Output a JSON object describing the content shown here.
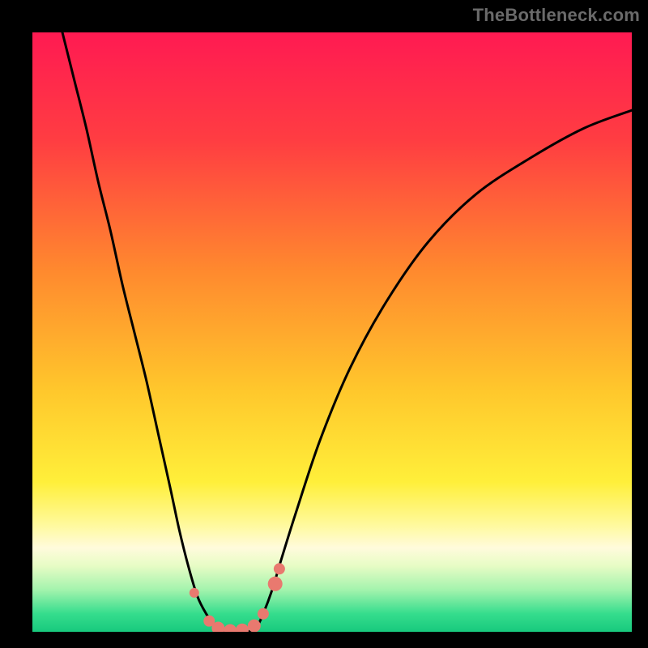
{
  "watermark": {
    "text": "TheBottleneck.com"
  },
  "colors": {
    "frame": "#000000",
    "gradient_stops": [
      {
        "offset": 0.0,
        "color": "#ff1a52"
      },
      {
        "offset": 0.18,
        "color": "#ff3d42"
      },
      {
        "offset": 0.4,
        "color": "#ff8a2e"
      },
      {
        "offset": 0.6,
        "color": "#ffc82c"
      },
      {
        "offset": 0.75,
        "color": "#ffef3a"
      },
      {
        "offset": 0.82,
        "color": "#fff99a"
      },
      {
        "offset": 0.86,
        "color": "#fffbdc"
      },
      {
        "offset": 0.89,
        "color": "#e7fcc5"
      },
      {
        "offset": 0.93,
        "color": "#a3f3ad"
      },
      {
        "offset": 0.97,
        "color": "#35dd8d"
      },
      {
        "offset": 1.0,
        "color": "#18c97d"
      }
    ],
    "curve": "#000000",
    "marker_fill": "#e9796f",
    "marker_stroke": "#d4645a"
  },
  "chart_data": {
    "type": "line",
    "title": "",
    "xlabel": "",
    "ylabel": "",
    "xlim": [
      0,
      100
    ],
    "ylim": [
      0,
      100
    ],
    "grid": false,
    "legend": false,
    "series": [
      {
        "name": "bottleneck-curve",
        "xy": [
          [
            5,
            100
          ],
          [
            7,
            92
          ],
          [
            9,
            84
          ],
          [
            11,
            75
          ],
          [
            13,
            67
          ],
          [
            15,
            58
          ],
          [
            17,
            50
          ],
          [
            19,
            42
          ],
          [
            21,
            33
          ],
          [
            23,
            24
          ],
          [
            24.5,
            17
          ],
          [
            26,
            11
          ],
          [
            27.5,
            6
          ],
          [
            29,
            3
          ],
          [
            30.5,
            1
          ],
          [
            32,
            0
          ],
          [
            34,
            0
          ],
          [
            36,
            0
          ],
          [
            37.5,
            1
          ],
          [
            38.5,
            3
          ],
          [
            40,
            7
          ],
          [
            41.5,
            12
          ],
          [
            44,
            20
          ],
          [
            48,
            32
          ],
          [
            53,
            44
          ],
          [
            59,
            55
          ],
          [
            66,
            65
          ],
          [
            74,
            73
          ],
          [
            83,
            79
          ],
          [
            92,
            84
          ],
          [
            100,
            87
          ]
        ]
      }
    ],
    "markers": [
      {
        "x": 27.0,
        "y": 6.5,
        "size": 6
      },
      {
        "x": 29.5,
        "y": 1.8,
        "size": 7
      },
      {
        "x": 31.0,
        "y": 0.6,
        "size": 8
      },
      {
        "x": 33.0,
        "y": 0.2,
        "size": 8
      },
      {
        "x": 35.0,
        "y": 0.3,
        "size": 8
      },
      {
        "x": 37.0,
        "y": 1.0,
        "size": 8
      },
      {
        "x": 38.5,
        "y": 3.0,
        "size": 7
      },
      {
        "x": 40.5,
        "y": 8.0,
        "size": 9
      },
      {
        "x": 41.2,
        "y": 10.5,
        "size": 7
      }
    ]
  }
}
